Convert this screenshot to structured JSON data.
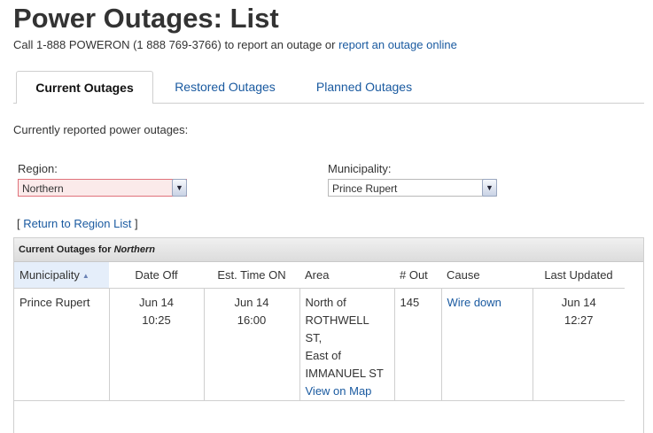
{
  "page": {
    "title": "Power Outages: List",
    "report_prefix": "Call 1-888 POWERON (1 888 769-3766) to report an outage or ",
    "report_link": "report an outage online"
  },
  "tabs": [
    {
      "label": "Current Outages",
      "active": true
    },
    {
      "label": "Restored Outages",
      "active": false
    },
    {
      "label": "Planned Outages",
      "active": false
    }
  ],
  "intro": "Currently reported power outages:",
  "filters": {
    "region_label": "Region:",
    "region_value": "Northern",
    "municipality_label": "Municipality:",
    "municipality_value": "Prince Rupert"
  },
  "return_link": {
    "open": "[ ",
    "label": "Return to Region List",
    "close": " ]"
  },
  "panel": {
    "header_prefix": "Current Outages for ",
    "header_region": "Northern"
  },
  "table": {
    "columns": [
      "Municipality",
      "Date Off",
      "Est. Time ON",
      "Area",
      "# Out",
      "Cause",
      "Last Updated"
    ],
    "rows": [
      {
        "municipality": "Prince Rupert",
        "date_off_day": "Jun 14",
        "date_off_time": "10:25",
        "est_on_day": "Jun 14",
        "est_on_time": "16:00",
        "area_lines": [
          "North of",
          "ROTHWELL ST,",
          "East of",
          "IMMANUEL ST"
        ],
        "area_link": "View on Map",
        "out": "145",
        "cause": "Wire down",
        "updated_day": "Jun 14",
        "updated_time": "12:27"
      }
    ]
  },
  "colors": {
    "link": "#1a5aa0",
    "error_border": "#e0727b",
    "sorted_header_bg": "#e5eefa"
  }
}
